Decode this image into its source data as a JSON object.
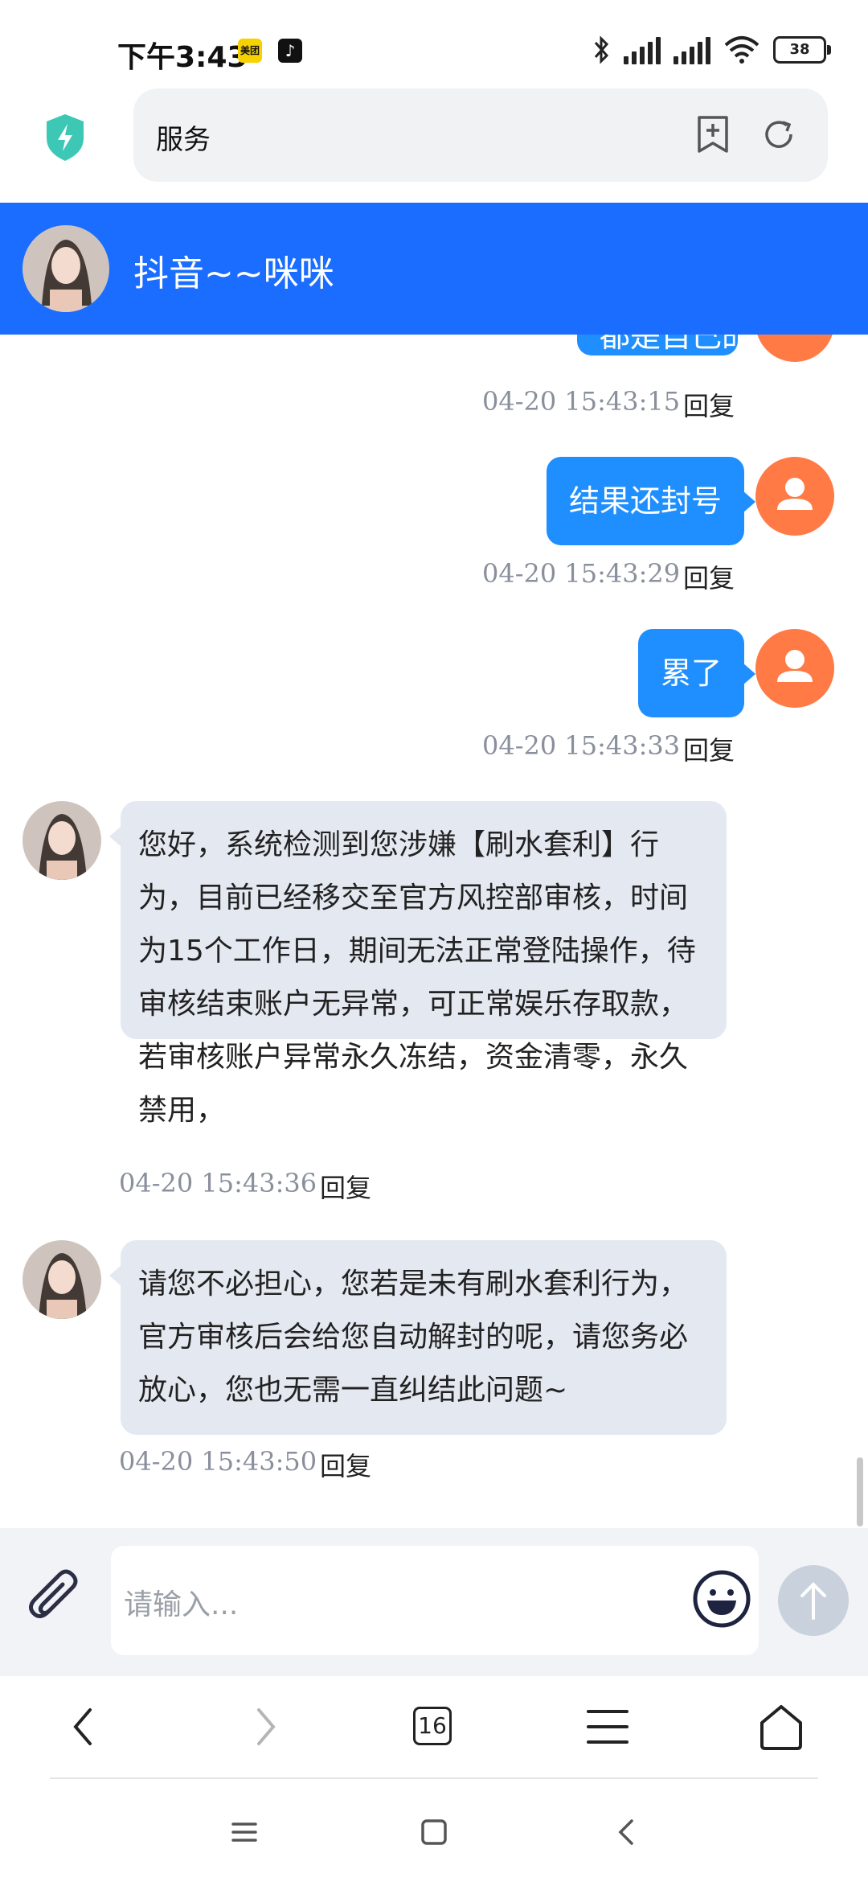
{
  "status_bar": {
    "time": "下午3:43",
    "app1_label": "美团",
    "app2_icon": "tiktok-icon",
    "battery": "38"
  },
  "address_bar": {
    "text": "服务"
  },
  "chat": {
    "title": "抖音~~咪咪",
    "reply_label": "回复",
    "messages": [
      {
        "direction": "out",
        "text": "都是自己的钱还要审核",
        "time": "04-20 15:43:15",
        "partial": true
      },
      {
        "direction": "out",
        "text": "结果还封号",
        "time": "04-20 15:43:29"
      },
      {
        "direction": "out",
        "text": "累了",
        "time": "04-20 15:43:33"
      },
      {
        "direction": "in",
        "text": "您好，系统检测到您涉嫌【刷水套利】行为，目前已经移交至官方风控部审核，时间为15个工作日，期间无法正常登陆操作，待审核结束账户无异常，可正常娱乐存取款，若审核账户异常永久冻结，资金清零，永久禁用，",
        "time": "04-20 15:43:36"
      },
      {
        "direction": "in",
        "text": "请您不必担心，您若是未有刷水套利行为，官方审核后会给您自动解封的呢，请您务必放心，您也无需一直纠结此问题~",
        "time": "04-20 15:43:50"
      }
    ]
  },
  "input": {
    "placeholder": "请输入..."
  },
  "browser_nav": {
    "tab_count": "16"
  },
  "colors": {
    "header_blue": "#1a6dff",
    "bubble_out": "#1f8fff",
    "bubble_in": "#e4e9f1",
    "avatar_orange": "#ff7a45"
  }
}
